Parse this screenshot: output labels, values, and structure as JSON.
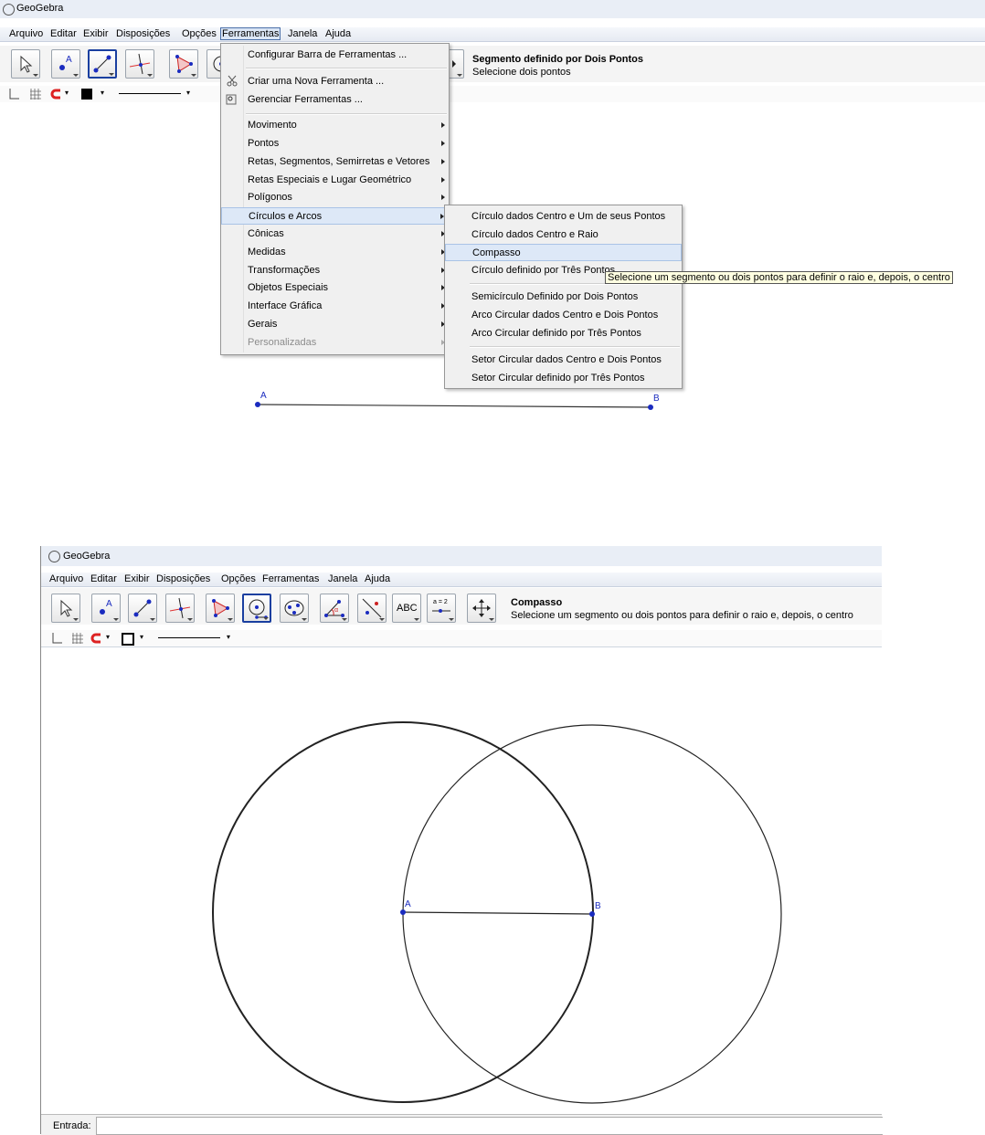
{
  "top": {
    "title": "GeoGebra",
    "menu": [
      "Arquivo",
      "Editar",
      "Exibir",
      "Disposições",
      "Opções",
      "Ferramentas",
      "Janela",
      "Ajuda"
    ],
    "help_title": "Segmento definido por Dois Pontos",
    "help_desc": "Selecione dois pontos",
    "ferramentas_menu": {
      "items": [
        {
          "label": "Configurar Barra de Ferramentas ..."
        },
        {
          "label": "Criar uma Nova Ferramenta ..."
        },
        {
          "label": "Gerenciar Ferramentas ..."
        },
        {
          "label": "Movimento"
        },
        {
          "label": "Pontos"
        },
        {
          "label": "Retas, Segmentos, Semirretas e Vetores"
        },
        {
          "label": "Retas Especiais e Lugar Geométrico"
        },
        {
          "label": "Polígonos"
        },
        {
          "label": "Círculos e Arcos"
        },
        {
          "label": "Cônicas"
        },
        {
          "label": "Medidas"
        },
        {
          "label": "Transformações"
        },
        {
          "label": "Objetos Especiais"
        },
        {
          "label": "Interface Gráfica"
        },
        {
          "label": "Gerais"
        },
        {
          "label": "Personalizadas"
        }
      ]
    },
    "circles_submenu": {
      "items": [
        {
          "label": "Círculo dados Centro e Um de seus Pontos"
        },
        {
          "label": "Círculo dados Centro e Raio"
        },
        {
          "label": "Compasso"
        },
        {
          "label": "Círculo definido por Três Pontos"
        },
        {
          "label": "Semicírculo Definido por Dois Pontos"
        },
        {
          "label": "Arco Circular dados Centro e Dois Pontos"
        },
        {
          "label": "Arco Circular definido por Três Pontos"
        },
        {
          "label": "Setor Circular dados Centro e Dois Pontos"
        },
        {
          "label": "Setor Circular definido por Três Pontos"
        }
      ]
    },
    "tooltip": "Selecione um segmento ou dois pontos para definir o raio e, depois, o centro",
    "points": {
      "a": "A",
      "b": "B"
    }
  },
  "bottom": {
    "title": "GeoGebra",
    "menu": [
      "Arquivo",
      "Editar",
      "Exibir",
      "Disposições",
      "Opções",
      "Ferramentas",
      "Janela",
      "Ajuda"
    ],
    "help_title": "Compasso",
    "help_desc": "Selecione um segmento ou dois pontos para definir o raio e, depois, o centro",
    "text_tool": "ABC",
    "slider_tool": "a = 2",
    "points": {
      "a": "A",
      "b": "B"
    },
    "input_label": "Entrada:"
  },
  "colors": {
    "point": "#1a2bbf",
    "active_tool_border": "#1a3fa0",
    "menu_highlight": "#dde8f7"
  }
}
